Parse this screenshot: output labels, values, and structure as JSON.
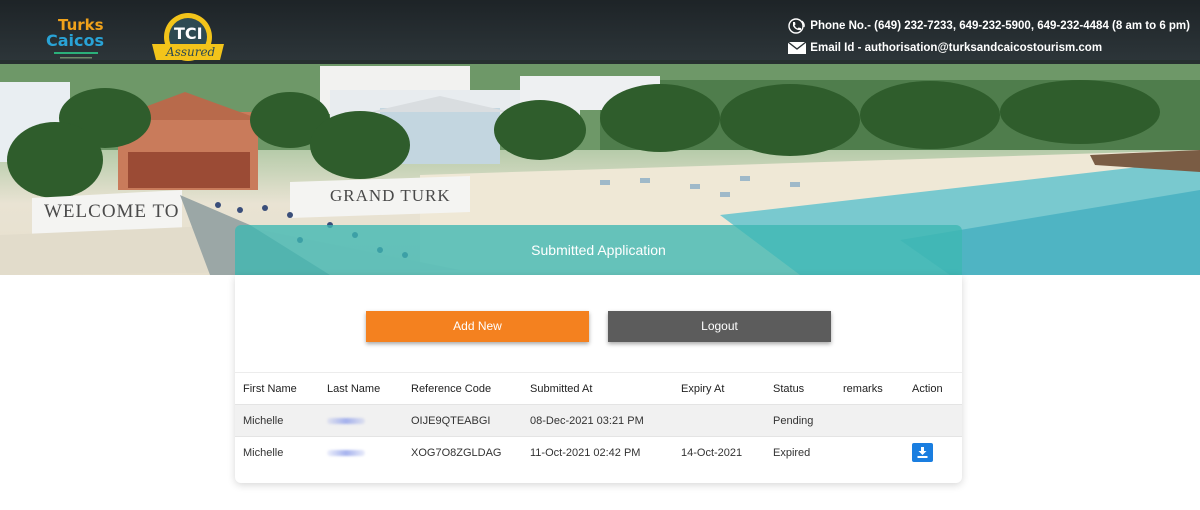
{
  "header": {
    "phone_label": "Phone No.- (649) 232-7233, 649-232-5900, 649-232-4484 (8 am to 6 pm)",
    "email_label": "Email Id - authorisation@turksandcaicostourism.com",
    "logo_tc_text": [
      "Turks",
      "Caicos"
    ],
    "logo_tci_text": [
      "TCI",
      "Assured"
    ],
    "icons": [
      "phone-icon",
      "envelope-icon"
    ]
  },
  "banner": {
    "sign_left": "WELCOME TO",
    "sign_right": "GRAND TURK"
  },
  "page": {
    "title": "Submitted Application",
    "add_new_label": "Add New",
    "logout_label": "Logout"
  },
  "table": {
    "columns": [
      "First Name",
      "Last Name",
      "Reference Code",
      "Submitted At",
      "Expiry At",
      "Status",
      "remarks",
      "Action"
    ],
    "rows": [
      {
        "first_name": "Michelle",
        "last_name": "",
        "reference_code": "OIJE9QTEABGI",
        "submitted_at": "08-Dec-2021 03:21 PM",
        "expiry_at": "",
        "status": "Pending",
        "remarks": "",
        "action": ""
      },
      {
        "first_name": "Michelle",
        "last_name": "",
        "reference_code": "XOG7O8ZGLDAG",
        "submitted_at": "11-Oct-2021 02:42 PM",
        "expiry_at": "14-Oct-2021",
        "status": "Expired",
        "remarks": "",
        "action": "download-icon"
      }
    ]
  },
  "colors": {
    "accent_orange": "#f4811f",
    "logout_gray": "#5c5c5c",
    "teal_header": "#3db7b2",
    "download_blue": "#1a7ee0"
  }
}
